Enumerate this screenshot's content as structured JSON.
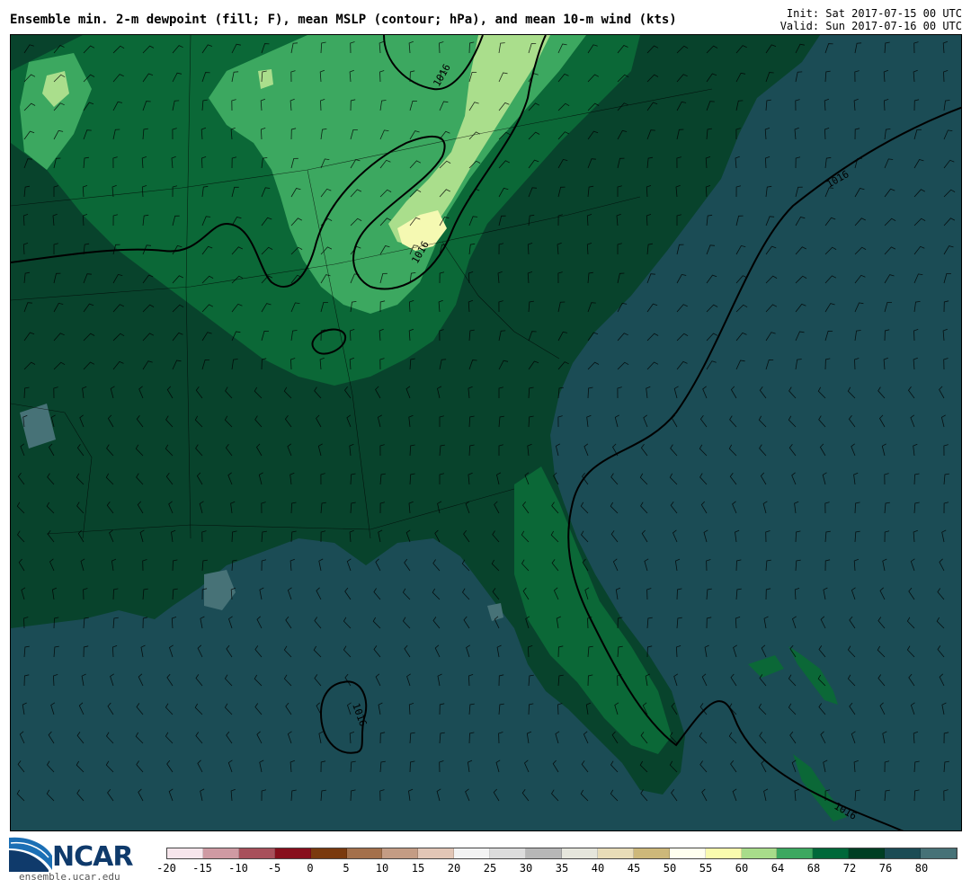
{
  "header": {
    "title": "Ensemble min. 2-m dewpoint (fill; F), mean MSLP (contour; hPa), and mean 10-m wind (kts)",
    "init": "Init: Sat 2017-07-15 00 UTC",
    "valid": "Valid: Sun 2017-07-16 00 UTC"
  },
  "map": {
    "contour_label": "1016",
    "colors": {
      "ocean": "#1b4c55",
      "land_76": "#08432c",
      "land_72": "#0b6837",
      "land_68": "#3ca860",
      "land_64": "#aade8c",
      "land_60": "#f5f9b2"
    }
  },
  "logo": {
    "brand": "NCAR",
    "url": "ensemble.ucar.edu"
  },
  "colorbar": {
    "colors": [
      "#f7e6ec",
      "#cf9aa3",
      "#a8505b",
      "#880f1c",
      "#7a3a0e",
      "#a4704b",
      "#c49c84",
      "#e2c6b6",
      "#f3f3f3",
      "#dcdcdc",
      "#b7b7b7",
      "#e6e6dc",
      "#e8dcb8",
      "#cdb87a",
      "#ffffee",
      "#f9fbae",
      "#a8dc8a",
      "#3ca860",
      "#00683a",
      "#003f24",
      "#1b4c55",
      "#477277"
    ],
    "ticks": [
      "-20",
      "-15",
      "-10",
      "-5",
      "0",
      "5",
      "10",
      "15",
      "20",
      "25",
      "30",
      "35",
      "40",
      "45",
      "50",
      "55",
      "60",
      "64",
      "68",
      "72",
      "76",
      "80"
    ]
  }
}
